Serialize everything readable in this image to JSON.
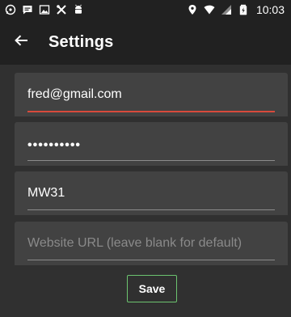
{
  "status_bar": {
    "time": "10:03",
    "left_icons": [
      "whatsapp-icon",
      "message-icon",
      "image-icon",
      "tools-icon",
      "android-icon"
    ],
    "right_icons": [
      "location-icon",
      "wifi-icon",
      "signal-icon",
      "battery-icon"
    ]
  },
  "app_bar": {
    "title": "Settings",
    "back_icon": "arrow-back-icon"
  },
  "form": {
    "email_value": "fred@gmail.com",
    "password_value": "••••••••••",
    "device_value": "MW31",
    "website_placeholder": "Website URL (leave blank for default)",
    "save_label": "Save"
  },
  "colors": {
    "background": "#303030",
    "bar_background": "#212121",
    "field_background": "#424242",
    "focus_underline": "#d84a3c",
    "save_border": "#6cc46f"
  }
}
